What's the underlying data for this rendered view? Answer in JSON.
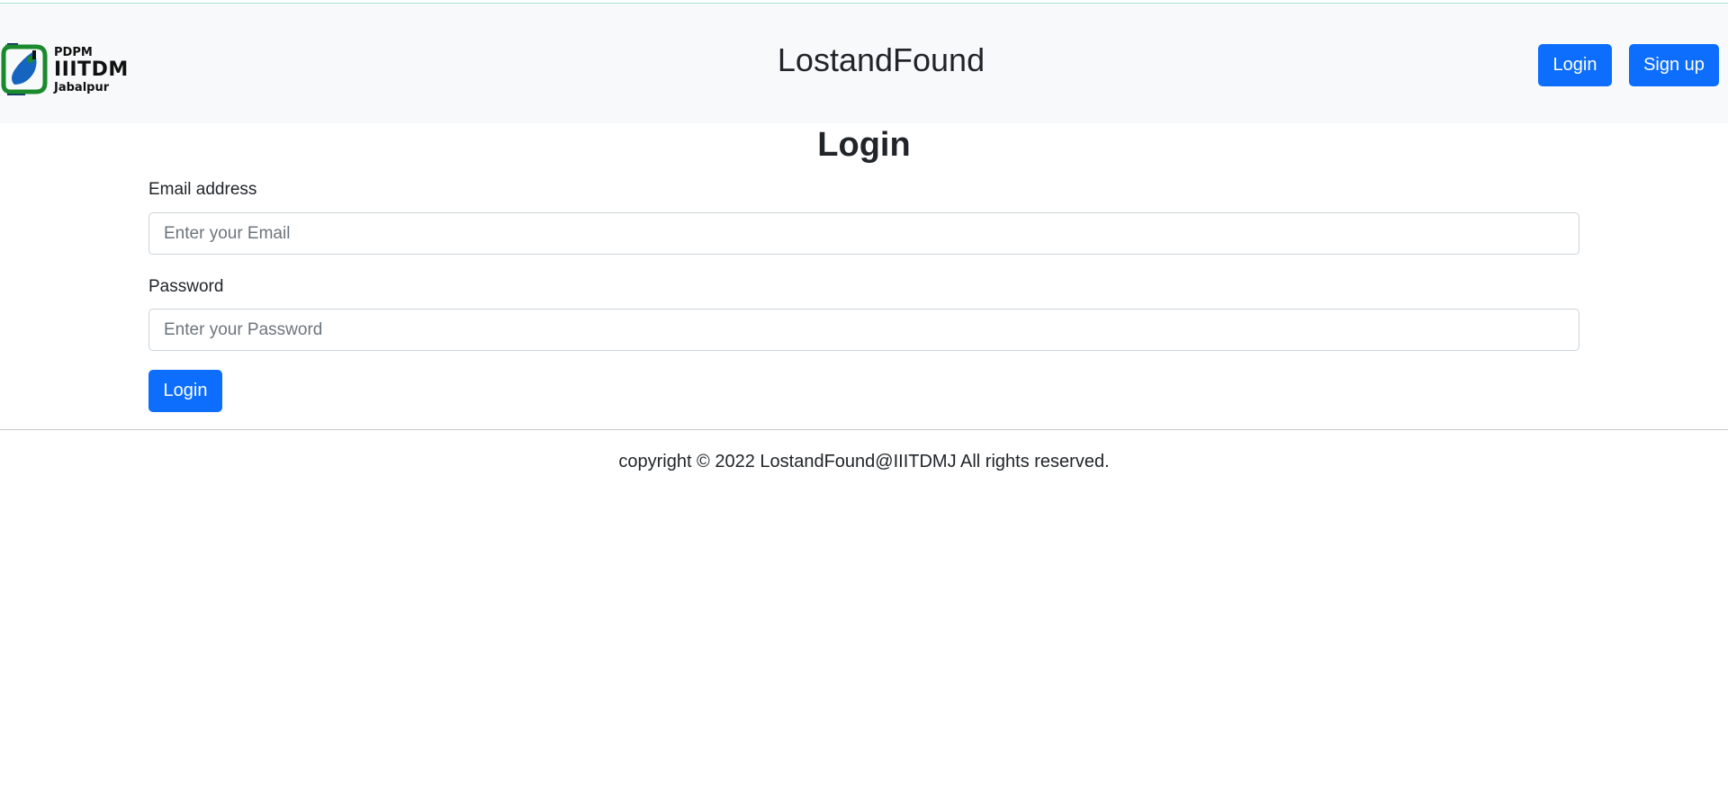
{
  "logo": {
    "line1": "PDPM",
    "line2": "IIITDM",
    "line3": "Jabalpur"
  },
  "navbar": {
    "brand": "LostandFound",
    "login_label": "Login",
    "signup_label": "Sign up"
  },
  "form": {
    "title": "Login",
    "email_label": "Email address",
    "email_placeholder": "Enter your Email",
    "password_label": "Password",
    "password_placeholder": "Enter your Password",
    "submit_label": "Login"
  },
  "footer": {
    "text": "copyright © 2022 LostandFound@IIITDMJ All rights reserved."
  },
  "colors": {
    "primary": "#0d6efd",
    "navbar_bg": "#f8f9fa",
    "logo_green": "#1b8a2e",
    "logo_blue": "#1565c0"
  }
}
